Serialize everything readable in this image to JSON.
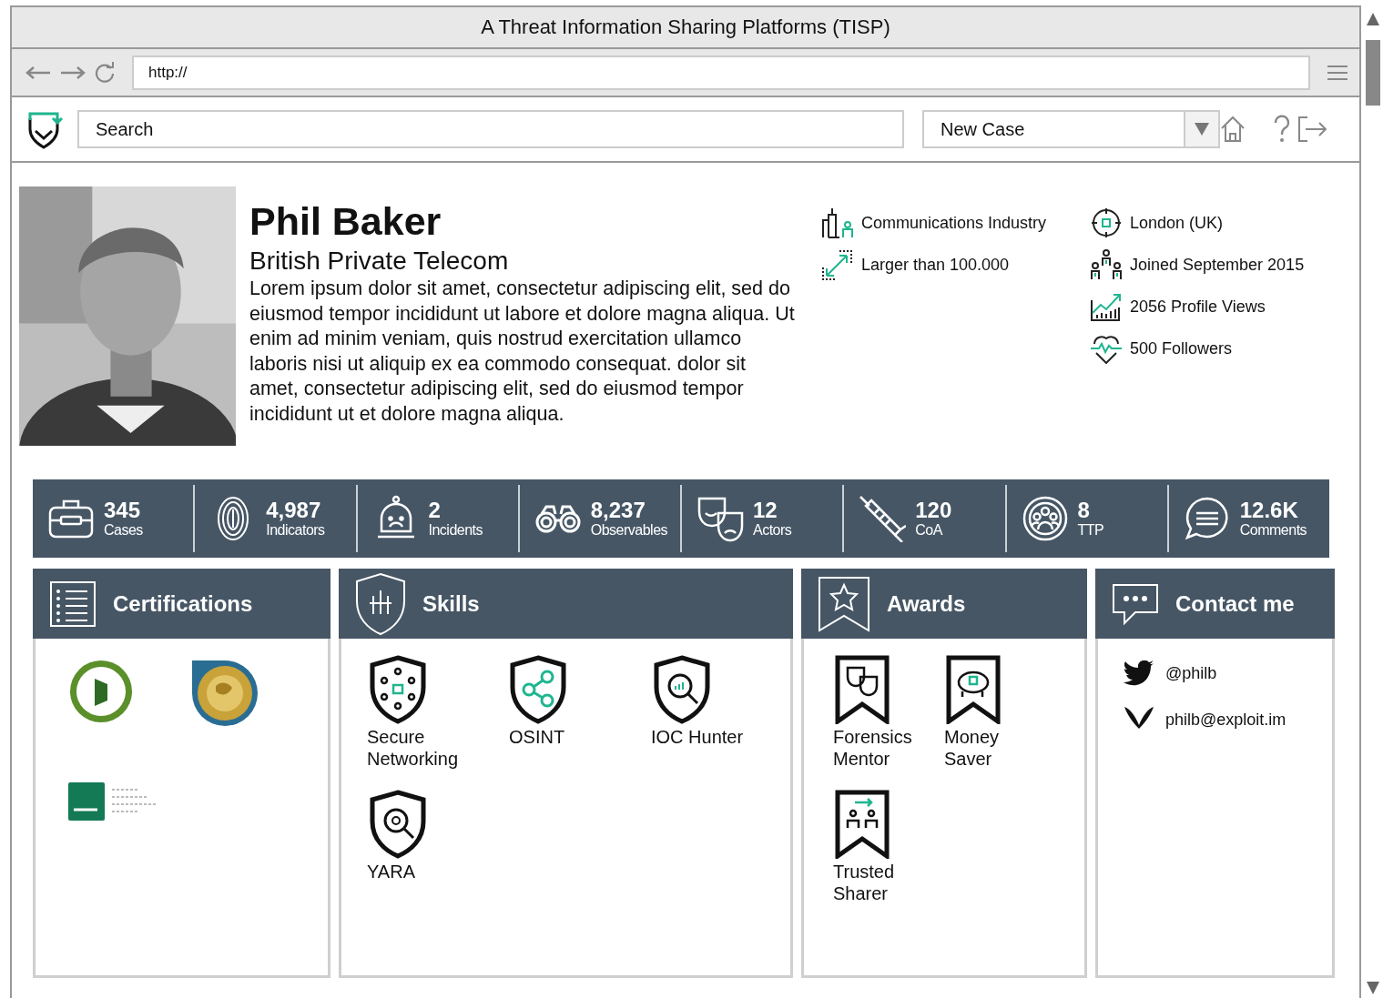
{
  "window": {
    "title": "A Threat Information Sharing Platforms (TISP)"
  },
  "address_bar": {
    "url": "http://"
  },
  "toolbar": {
    "search": {
      "placeholder": "Search"
    },
    "case_select": {
      "value": "New Case"
    }
  },
  "profile": {
    "name": "Phil Baker",
    "company": "British Private Telecom",
    "bio": "Lorem ipsum dolor sit amet, consectetur adipiscing elit, sed do eiusmod tempor incididunt ut labore et dolore magna aliqua. Ut enim ad minim veniam, quis nostrud exercitation ullamco laboris nisi ut aliquip ex ea commodo consequat. dolor sit amet, consectetur adipiscing elit, sed do eiusmod tempor incididunt ut et dolore magna aliqua.",
    "facts_left": [
      {
        "kind": "industry",
        "text": "Communications Industry"
      },
      {
        "kind": "size",
        "text": "Larger than 100.000"
      }
    ],
    "facts_right": [
      {
        "kind": "location",
        "text": "London (UK)"
      },
      {
        "kind": "joined",
        "text": "Joined September 2015"
      },
      {
        "kind": "views",
        "text": "2056 Profile Views"
      },
      {
        "kind": "followers",
        "text": "500 Followers"
      }
    ]
  },
  "stats": [
    {
      "kind": "cases",
      "value": "345",
      "label": "Cases"
    },
    {
      "kind": "indicators",
      "value": "4,987",
      "label": "Indicators"
    },
    {
      "kind": "incidents",
      "value": "2",
      "label": "Incidents"
    },
    {
      "kind": "observables",
      "value": "8,237",
      "label": "Observables"
    },
    {
      "kind": "actors",
      "value": "12",
      "label": "Actors"
    },
    {
      "kind": "coa",
      "value": "120",
      "label": "CoA"
    },
    {
      "kind": "ttp",
      "value": "8",
      "label": "TTP"
    },
    {
      "kind": "comments",
      "value": "12.6K",
      "label": "Comments"
    }
  ],
  "certifications": {
    "title": "Certifications",
    "badges": [
      {
        "kind": "ibm"
      },
      {
        "kind": "gcia"
      },
      {
        "kind": "cissp"
      }
    ]
  },
  "skills": {
    "title": "Skills",
    "items": [
      {
        "kind": "network",
        "label": "Secure Networking"
      },
      {
        "kind": "osint",
        "label": "OSINT"
      },
      {
        "kind": "ioc",
        "label": "IOC Hunter"
      },
      {
        "kind": "yara",
        "label": "YARA"
      }
    ]
  },
  "awards": {
    "title": "Awards",
    "items": [
      {
        "kind": "mentor",
        "label": "Forensics Mentor"
      },
      {
        "kind": "saver",
        "label": "Money Saver"
      },
      {
        "kind": "sharer",
        "label": "Trusted Sharer"
      }
    ]
  },
  "contact": {
    "title": "Contact me",
    "items": [
      {
        "kind": "twitter",
        "text": "@philb"
      },
      {
        "kind": "xmpp",
        "text": "philb@exploit.im"
      }
    ]
  }
}
